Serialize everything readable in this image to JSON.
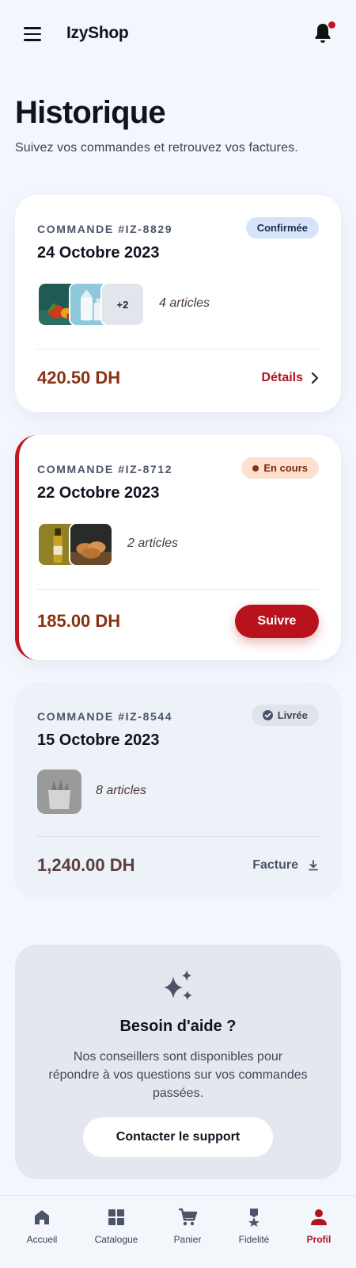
{
  "app": {
    "brand": "IzyShop"
  },
  "header": {
    "title": "Historique",
    "subtitle": "Suivez vos commandes et retrouvez vos factures."
  },
  "orders": [
    {
      "number": "COMMANDE #IZ-8829",
      "date": "24 Octobre 2023",
      "status": "Confirmée",
      "extra_items": "+2",
      "items_count": "4 articles",
      "total": "420.50 DH",
      "action": "Détails"
    },
    {
      "number": "COMMANDE #IZ-8712",
      "date": "22 Octobre 2023",
      "status": "En cours",
      "items_count": "2 articles",
      "total": "185.00 DH",
      "action": "Suivre"
    },
    {
      "number": "COMMANDE #IZ-8544",
      "date": "15 Octobre 2023",
      "status": "Livrée",
      "items_count": "8 articles",
      "total": "1,240.00 DH",
      "action": "Facture"
    }
  ],
  "help": {
    "title": "Besoin d'aide ?",
    "text": "Nos conseillers sont disponibles pour répondre à vos questions sur vos commandes passées.",
    "button": "Contacter le support"
  },
  "nav": [
    {
      "label": "Accueil",
      "icon": "home-icon"
    },
    {
      "label": "Catalogue",
      "icon": "grid-icon"
    },
    {
      "label": "Panier",
      "icon": "cart-icon"
    },
    {
      "label": "Fidelité",
      "icon": "medal-icon"
    },
    {
      "label": "Profil",
      "icon": "person-icon",
      "active": true
    }
  ],
  "colors": {
    "accent": "#b8121c",
    "background": "#f3f7fd",
    "price": "#8a3210"
  }
}
